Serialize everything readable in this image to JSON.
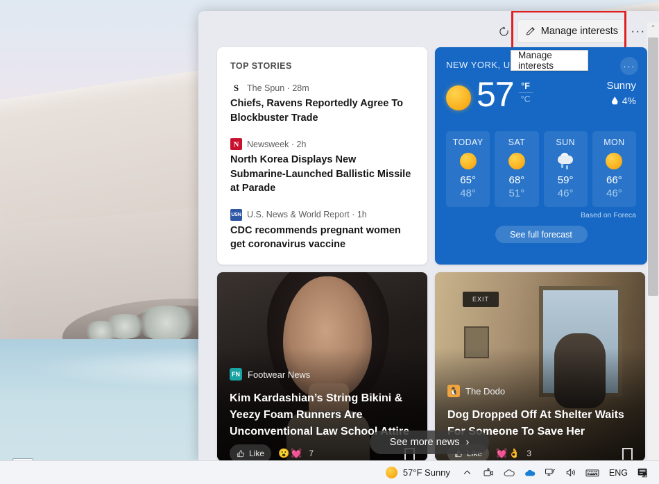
{
  "desktop": {
    "icon": {
      "name": "task-manager-icon"
    }
  },
  "flyout": {
    "header": {
      "refresh_icon": "refresh-icon",
      "manage_label": "Manage interests",
      "manage_icon": "pencil-icon",
      "ellipsis_label": "···",
      "tooltip_text": "Manage interests"
    },
    "top_stories": {
      "title": "TOP STORIES",
      "stories": [
        {
          "source": "The Spun",
          "time": "28m",
          "meta": "The Spun · 28m",
          "logo_text": "S",
          "logo_bg": "#ffffff",
          "logo_fg": "#111111",
          "headline": "Chiefs, Ravens Reportedly Agree To Blockbuster Trade"
        },
        {
          "source": "Newsweek",
          "time": "2h",
          "meta": "Newsweek · 2h",
          "logo_text": "N",
          "logo_bg": "#c8102e",
          "logo_fg": "#ffffff",
          "headline": "North Korea Displays New Submarine-Launched Ballistic Missile at Parade"
        },
        {
          "source": "U.S. News & World Report",
          "time": "1h",
          "meta": "U.S. News & World Report · 1h",
          "logo_text": "USN",
          "logo_bg": "#2d57a5",
          "logo_fg": "#ffffff",
          "headline": "CDC recommends pregnant women get coronavirus vaccine"
        }
      ]
    },
    "weather": {
      "location": "NEW YORK, UNITED STATES",
      "more_label": "···",
      "temperature": "57",
      "unit_f": "°F",
      "unit_c": "°C",
      "condition": "Sunny",
      "precipitation": "4%",
      "attribution": "Based on Foreca",
      "full_forecast_label": "See full forecast",
      "accent_color": "#1668c4",
      "forecast": [
        {
          "day": "TODAY",
          "icon": "sunny-icon",
          "high": "65°",
          "low": "48°"
        },
        {
          "day": "SAT",
          "icon": "sunny-icon",
          "high": "68°",
          "low": "51°"
        },
        {
          "day": "SUN",
          "icon": "rainy-icon",
          "high": "59°",
          "low": "46°"
        },
        {
          "day": "MON",
          "icon": "sunny-icon",
          "high": "66°",
          "low": "46°"
        }
      ]
    },
    "news_cards": [
      {
        "source": "Footwear News",
        "logo_text": "FN",
        "logo_bg": "#1aa3a3",
        "headline": "Kim Kardashian’s String Bikini & Yeezy Foam Runners Are Unconventional Law School Attire",
        "reaction_label": "Like",
        "reaction_count": "7"
      },
      {
        "source": "The Dodo",
        "logo_text": "",
        "logo_bg": "#f2a33c",
        "headline": "Dog Dropped Off At Shelter Waits For Someone To Save Her",
        "reaction_label": "Like",
        "reaction_count": "3"
      }
    ],
    "see_more_label": "See more news",
    "see_more_chevron": "›",
    "scrollbar": {
      "up_arrow": "⌃"
    }
  },
  "taskbar": {
    "weather_text": "57°F  Sunny",
    "chevron_up": "⌃",
    "language": "ENG",
    "icons": [
      "show-hidden-icons",
      "camera-icon",
      "onedrive-personal-icon",
      "onedrive-work-icon",
      "network-icon",
      "volume-icon",
      "keyboard-icon"
    ]
  }
}
